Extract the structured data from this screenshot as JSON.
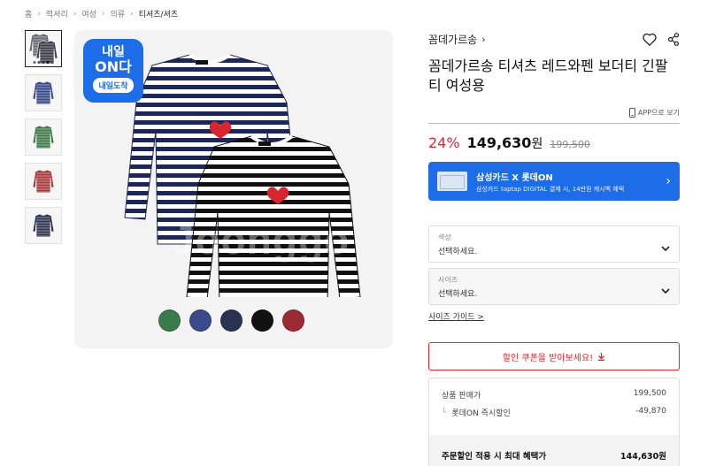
{
  "breadcrumb": [
    "홈",
    "럭셔리",
    "여성",
    "의류",
    "티셔츠/셔츠"
  ],
  "thumbnails": [
    {
      "name": "thumb-combo",
      "colors": [
        "#666b75",
        "#3a3d45"
      ]
    },
    {
      "name": "thumb-navy",
      "colors": [
        "#3a4a8a"
      ]
    },
    {
      "name": "thumb-green",
      "colors": [
        "#3f7a48"
      ]
    },
    {
      "name": "thumb-red",
      "colors": [
        "#a83a3e"
      ]
    },
    {
      "name": "thumb-navy-dark",
      "colors": [
        "#2f3550"
      ]
    }
  ],
  "main_image": {
    "badge_line1": "내일",
    "badge_line2": "ON다",
    "badge_line3": "내일도착",
    "watermark": "Joonggo"
  },
  "swatches": [
    "#3b7a4a",
    "#3a4a8a",
    "#2b3150",
    "#111111",
    "#9c2a33"
  ],
  "product": {
    "brand": "꼼데가르송",
    "title": "꼼데가르송 티셔츠 레드와펜 보더티 긴팔티 여성용",
    "app_link": "APP으로 보기",
    "discount": "24%",
    "price": "149,630",
    "price_unit": "원",
    "original_price": "199,500"
  },
  "card_banner": {
    "title": "삼성카드 X 롯데ON",
    "desc": "삼성카드 taptap DIGITAL 결제 시, 14만원 캐시백 혜택"
  },
  "options": [
    {
      "label": "색상",
      "value": "선택하세요."
    },
    {
      "label": "사이즈",
      "value": "선택하세요."
    }
  ],
  "size_guide": "사이즈 가이드 >",
  "coupon_button": "할인 쿠폰을 받아보세요!",
  "summary": {
    "sale_price_label": "상품 판매가",
    "sale_price_value": "199,500",
    "instant_discount_label": "롯데ON 즉시할인",
    "instant_discount_value": "-49,870",
    "max_benefit_label": "주문할인 적용 시 최대 혜택가",
    "max_benefit_value": "144,630원"
  },
  "colors": {
    "accent_red": "#e9232d",
    "accent_blue": "#1e6de8"
  }
}
